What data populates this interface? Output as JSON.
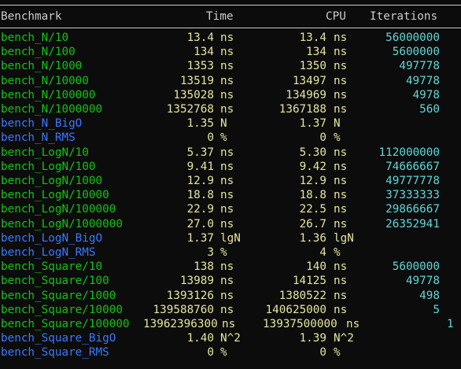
{
  "header": {
    "benchmark": "Benchmark",
    "time": "Time",
    "cpu": "CPU",
    "iterations": "Iterations"
  },
  "colors": {
    "background": "#0c0c0c",
    "header_text": "#cccccc",
    "benchmark_name": "#13c313",
    "complexity_name": "#3b78ff",
    "time_cpu_values": "#e5e5a0",
    "iterations": "#61d6d6"
  },
  "rows": [
    {
      "name": "bench_N/10",
      "kind": "bench",
      "time": "13.4",
      "time_unit": "ns",
      "cpu": "13.4",
      "cpu_unit": "ns",
      "iterations": "56000000"
    },
    {
      "name": "bench_N/100",
      "kind": "bench",
      "time": "134",
      "time_unit": "ns",
      "cpu": "134",
      "cpu_unit": "ns",
      "iterations": "5600000"
    },
    {
      "name": "bench_N/1000",
      "kind": "bench",
      "time": "1353",
      "time_unit": "ns",
      "cpu": "1350",
      "cpu_unit": "ns",
      "iterations": "497778"
    },
    {
      "name": "bench_N/10000",
      "kind": "bench",
      "time": "13519",
      "time_unit": "ns",
      "cpu": "13497",
      "cpu_unit": "ns",
      "iterations": "49778"
    },
    {
      "name": "bench_N/100000",
      "kind": "bench",
      "time": "135028",
      "time_unit": "ns",
      "cpu": "134969",
      "cpu_unit": "ns",
      "iterations": "4978"
    },
    {
      "name": "bench_N/1000000",
      "kind": "bench",
      "time": "1352768",
      "time_unit": "ns",
      "cpu": "1367188",
      "cpu_unit": "ns",
      "iterations": "560"
    },
    {
      "name": "bench_N_BigO",
      "kind": "complexity",
      "time": "1.35",
      "time_unit": "N",
      "cpu": "1.37",
      "cpu_unit": "N",
      "iterations": ""
    },
    {
      "name": "bench_N_RMS",
      "kind": "complexity",
      "time": "0",
      "time_unit": "%",
      "cpu": "0",
      "cpu_unit": "%",
      "iterations": ""
    },
    {
      "name": "bench_LogN/10",
      "kind": "bench",
      "time": "5.37",
      "time_unit": "ns",
      "cpu": "5.30",
      "cpu_unit": "ns",
      "iterations": "112000000"
    },
    {
      "name": "bench_LogN/100",
      "kind": "bench",
      "time": "9.41",
      "time_unit": "ns",
      "cpu": "9.42",
      "cpu_unit": "ns",
      "iterations": "74666667"
    },
    {
      "name": "bench_LogN/1000",
      "kind": "bench",
      "time": "12.9",
      "time_unit": "ns",
      "cpu": "12.9",
      "cpu_unit": "ns",
      "iterations": "49777778"
    },
    {
      "name": "bench_LogN/10000",
      "kind": "bench",
      "time": "18.8",
      "time_unit": "ns",
      "cpu": "18.8",
      "cpu_unit": "ns",
      "iterations": "37333333"
    },
    {
      "name": "bench_LogN/100000",
      "kind": "bench",
      "time": "22.9",
      "time_unit": "ns",
      "cpu": "22.5",
      "cpu_unit": "ns",
      "iterations": "29866667"
    },
    {
      "name": "bench_LogN/1000000",
      "kind": "bench",
      "time": "27.0",
      "time_unit": "ns",
      "cpu": "26.7",
      "cpu_unit": "ns",
      "iterations": "26352941"
    },
    {
      "name": "bench_LogN_BigO",
      "kind": "complexity",
      "time": "1.37",
      "time_unit": "lgN",
      "cpu": "1.36",
      "cpu_unit": "lgN",
      "iterations": ""
    },
    {
      "name": "bench_LogN_RMS",
      "kind": "complexity",
      "time": "3",
      "time_unit": "%",
      "cpu": "4",
      "cpu_unit": "%",
      "iterations": ""
    },
    {
      "name": "bench_Square/10",
      "kind": "bench",
      "time": "138",
      "time_unit": "ns",
      "cpu": "140",
      "cpu_unit": "ns",
      "iterations": "5600000"
    },
    {
      "name": "bench_Square/100",
      "kind": "bench",
      "time": "13989",
      "time_unit": "ns",
      "cpu": "14125",
      "cpu_unit": "ns",
      "iterations": "49778"
    },
    {
      "name": "bench_Square/1000",
      "kind": "bench",
      "time": "1393126",
      "time_unit": "ns",
      "cpu": "1380522",
      "cpu_unit": "ns",
      "iterations": "498"
    },
    {
      "name": "bench_Square/10000",
      "kind": "bench",
      "time": "139588760",
      "time_unit": "ns",
      "cpu": "140625000",
      "cpu_unit": "ns",
      "iterations": "5"
    },
    {
      "name": "bench_Square/100000",
      "kind": "bench",
      "time": "13962396300",
      "time_unit": "ns",
      "cpu": "13937500000",
      "cpu_unit": "ns",
      "iterations": "1"
    },
    {
      "name": "bench_Square_BigO",
      "kind": "complexity",
      "time": "1.40",
      "time_unit": "N^2",
      "cpu": "1.39",
      "cpu_unit": "N^2",
      "iterations": ""
    },
    {
      "name": "bench_Square_RMS",
      "kind": "complexity",
      "time": "0",
      "time_unit": "%",
      "cpu": "0",
      "cpu_unit": "%",
      "iterations": ""
    }
  ]
}
